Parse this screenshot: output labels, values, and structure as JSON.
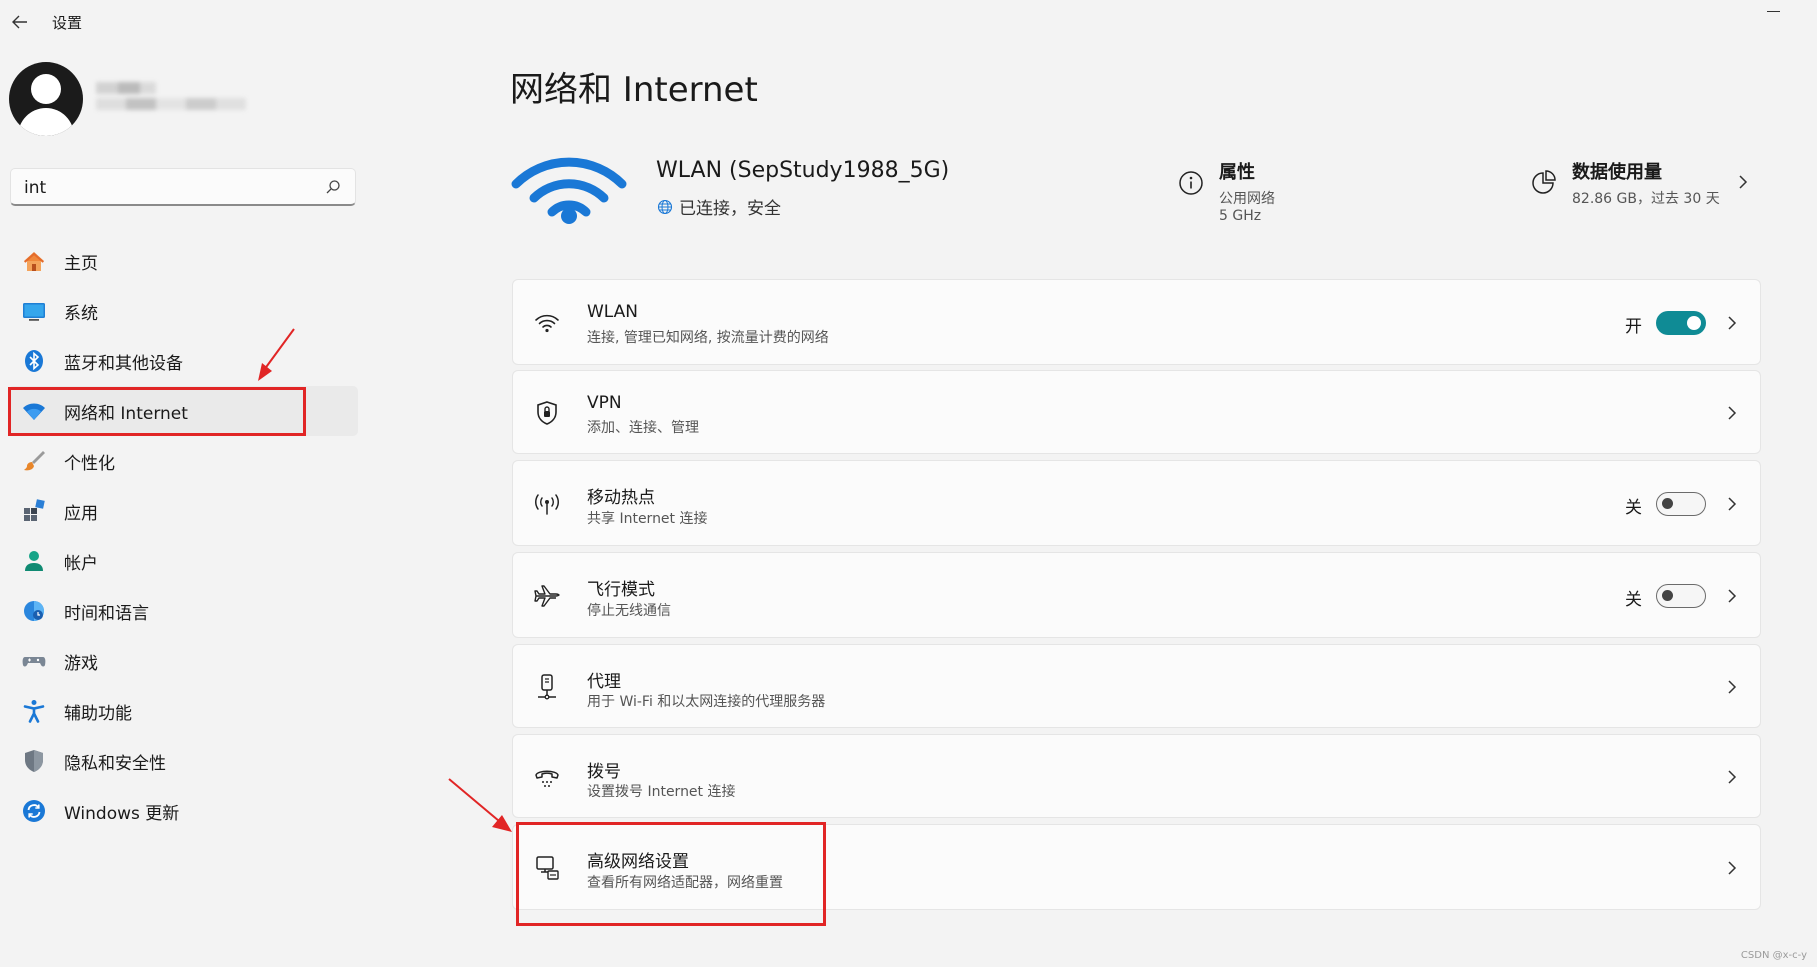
{
  "window": {
    "title": "设置",
    "back_icon": "arrow-left-icon",
    "minimize_icon": "minimize-icon"
  },
  "profile": {
    "avatar_icon": "person-icon",
    "name": "(blurred)"
  },
  "search": {
    "value": "int",
    "icon": "search-icon"
  },
  "sidebar": {
    "items": [
      {
        "label": "主页",
        "icon": "home-icon"
      },
      {
        "label": "系统",
        "icon": "monitor-icon"
      },
      {
        "label": "蓝牙和其他设备",
        "icon": "bluetooth-icon"
      },
      {
        "label": "网络和 Internet",
        "icon": "wifi-icon",
        "active": true
      },
      {
        "label": "个性化",
        "icon": "brush-icon"
      },
      {
        "label": "应用",
        "icon": "apps-icon"
      },
      {
        "label": "帐户",
        "icon": "account-icon"
      },
      {
        "label": "时间和语言",
        "icon": "globe-clock-icon"
      },
      {
        "label": "游戏",
        "icon": "gamepad-icon"
      },
      {
        "label": "辅助功能",
        "icon": "accessibility-icon"
      },
      {
        "label": "隐私和安全性",
        "icon": "shield-icon"
      },
      {
        "label": "Windows 更新",
        "icon": "update-icon"
      }
    ]
  },
  "main": {
    "title": "网络和 Internet",
    "connection": {
      "name": "WLAN (SepStudy1988_5G)",
      "status": "已连接，安全",
      "icon": "wifi-large-icon"
    },
    "properties": {
      "title": "属性",
      "line1": "公用网络",
      "line2": "5 GHz",
      "icon": "info-icon"
    },
    "data_usage": {
      "title": "数据使用量",
      "detail": "82.86 GB，过去 30 天",
      "icon": "pie-chart-icon"
    },
    "cards": [
      {
        "title": "WLAN",
        "sub": "连接, 管理已知网络, 按流量计费的网络",
        "icon": "wifi-icon",
        "toggle": true,
        "state": "开",
        "on": true
      },
      {
        "title": "VPN",
        "sub": "添加、连接、管理",
        "icon": "vpn-shield-icon",
        "toggle": false
      },
      {
        "title": "移动热点",
        "sub": "共享 Internet 连接",
        "icon": "hotspot-icon",
        "toggle": true,
        "state": "关",
        "on": false
      },
      {
        "title": "飞行模式",
        "sub": "停止无线通信",
        "icon": "airplane-icon",
        "toggle": true,
        "state": "关",
        "on": false
      },
      {
        "title": "代理",
        "sub": "用于 Wi-Fi 和以太网连接的代理服务器",
        "icon": "proxy-icon",
        "toggle": false
      },
      {
        "title": "拨号",
        "sub": "设置拨号 Internet 连接",
        "icon": "dialup-icon",
        "toggle": false
      },
      {
        "title": "高级网络设置",
        "sub": "查看所有网络适配器，网络重置",
        "icon": "network-adapter-icon",
        "toggle": false
      }
    ]
  },
  "colors": {
    "accent": "#0f8b95",
    "annotation": "#e12525",
    "background": "#f3f3f3",
    "card": "#fbfbfb"
  },
  "watermark": "CSDN @x-c-y"
}
